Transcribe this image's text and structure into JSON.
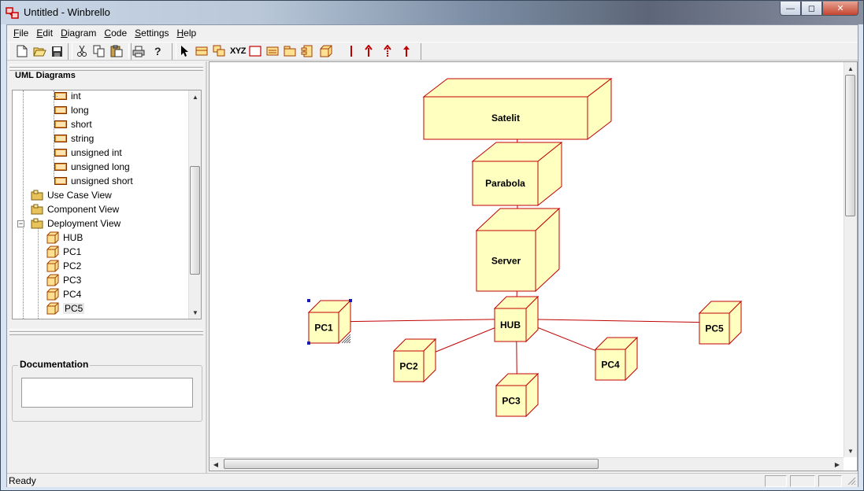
{
  "window": {
    "title": "Untitled - Winbrello"
  },
  "menu": [
    {
      "label": "File",
      "mnemonic": "F",
      "rest": "ile"
    },
    {
      "label": "Edit",
      "mnemonic": "E",
      "rest": "dit"
    },
    {
      "label": "Diagram",
      "mnemonic": "D",
      "rest": "iagram"
    },
    {
      "label": "Code",
      "mnemonic": "C",
      "rest": "ode"
    },
    {
      "label": "Settings",
      "mnemonic": "S",
      "rest": "ettings"
    },
    {
      "label": "Help",
      "mnemonic": "H",
      "rest": "elp"
    }
  ],
  "toolbar": {
    "file_tools": [
      "new-icon",
      "open-folder-icon",
      "save-icon"
    ],
    "edit_tools": [
      "cut-icon",
      "copy-icon",
      "paste-icon"
    ],
    "misc_tools": [
      "print-icon",
      "help-icon"
    ],
    "diagram_tools": [
      "pointer-icon",
      "class-icon",
      "interface-icon",
      "text-tool-icon",
      "rectangle-icon",
      "note-icon",
      "package-icon",
      "component-icon",
      "node-icon",
      "association-icon",
      "dependency-icon",
      "generalization-icon"
    ],
    "text_tool_label": "XYZ"
  },
  "left_pane": {
    "title": "UML Diagrams",
    "tree": [
      {
        "label": "int",
        "type": "datatype"
      },
      {
        "label": "long",
        "type": "datatype"
      },
      {
        "label": "short",
        "type": "datatype"
      },
      {
        "label": "string",
        "type": "datatype"
      },
      {
        "label": "unsigned int",
        "type": "datatype"
      },
      {
        "label": "unsigned long",
        "type": "datatype"
      },
      {
        "label": "unsigned short",
        "type": "datatype"
      },
      {
        "label": "Use Case View",
        "type": "folder"
      },
      {
        "label": "Component View",
        "type": "folder"
      },
      {
        "label": "Deployment View",
        "type": "folder"
      },
      {
        "label": "HUB",
        "type": "node"
      },
      {
        "label": "PC1",
        "type": "node"
      },
      {
        "label": "PC2",
        "type": "node"
      },
      {
        "label": "PC3",
        "type": "node"
      },
      {
        "label": "PC4",
        "type": "node"
      },
      {
        "label": "PC5",
        "type": "node"
      }
    ],
    "documentation_label": "Documentation",
    "documentation_value": ""
  },
  "diagram": {
    "nodes": [
      {
        "id": "satelit",
        "label": "Satelit"
      },
      {
        "id": "parabola",
        "label": "Parabola"
      },
      {
        "id": "server",
        "label": "Server"
      },
      {
        "id": "hub",
        "label": "HUB"
      },
      {
        "id": "pc1",
        "label": "PC1"
      },
      {
        "id": "pc2",
        "label": "PC2"
      },
      {
        "id": "pc3",
        "label": "PC3"
      },
      {
        "id": "pc4",
        "label": "PC4"
      },
      {
        "id": "pc5",
        "label": "PC5"
      }
    ],
    "connections": [
      [
        "satelit",
        "parabola"
      ],
      [
        "parabola",
        "server"
      ],
      [
        "server",
        "hub"
      ],
      [
        "hub",
        "pc1"
      ],
      [
        "hub",
        "pc2"
      ],
      [
        "hub",
        "pc3"
      ],
      [
        "hub",
        "pc4"
      ],
      [
        "hub",
        "pc5"
      ]
    ],
    "selected_node": "pc1",
    "node_fill": "#ffffc0",
    "node_stroke": "#c00000",
    "line_color": "#c00000"
  },
  "status": {
    "text": "Ready"
  }
}
